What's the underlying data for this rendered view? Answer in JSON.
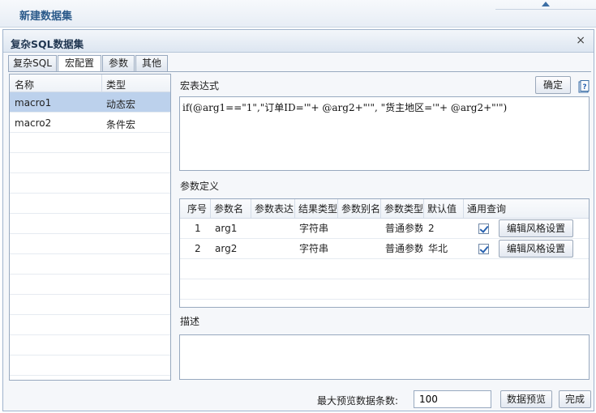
{
  "app": {
    "title": "新建数据集"
  },
  "dialog": {
    "title": "复杂SQL数据集",
    "close_glyph": "×",
    "tabs": [
      "复杂SQL",
      "宏配置",
      "参数",
      "其他"
    ]
  },
  "macro_list": {
    "columns": [
      "名称",
      "类型"
    ],
    "rows": [
      {
        "name": "macro1",
        "type": "动态宏",
        "selected": true
      },
      {
        "name": "macro2",
        "type": "条件宏",
        "selected": false
      }
    ]
  },
  "expression": {
    "label": "宏表达式",
    "confirm_label": "确定",
    "value": "if(@arg1==\"1\",\"订单ID='\"+ @arg2+\"'\", \"货主地区='\"+ @arg2+\"'\")"
  },
  "params": {
    "label": "参数定义",
    "columns": [
      "序号",
      "参数名",
      "参数表达",
      "结果类型",
      "参数别名",
      "参数类型",
      "默认值",
      "通用查询"
    ],
    "rows": [
      {
        "index": "1",
        "name": "arg1",
        "expr": "",
        "result_type": "字符串",
        "alias": "",
        "param_type": "普通参数",
        "default": "2",
        "general_query": true,
        "style_label": "编辑风格设置"
      },
      {
        "index": "2",
        "name": "arg2",
        "expr": "",
        "result_type": "字符串",
        "alias": "",
        "param_type": "普通参数",
        "default": "华北",
        "general_query": true,
        "style_label": "编辑风格设置"
      }
    ]
  },
  "description": {
    "label": "描述",
    "value": ""
  },
  "footer": {
    "max_rows_label": "最大预览数据条数:",
    "max_rows_value": "100",
    "preview_label": "数据预览",
    "finish_label": "完成"
  },
  "icons": {
    "help": "help-icon",
    "collapse": "collapse-arrow-icon",
    "close": "close-icon"
  }
}
